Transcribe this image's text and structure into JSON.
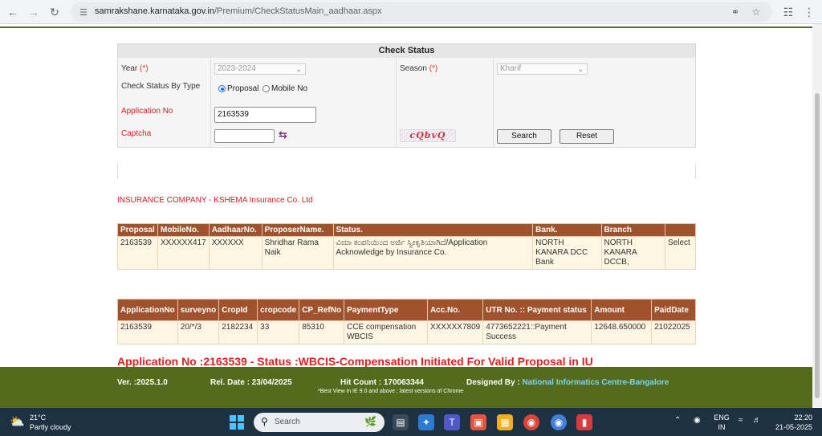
{
  "browser": {
    "url_domain": "samrakshane.karnataka.gov.in",
    "url_path": "/Premium/CheckStatusMain_aadhaar.aspx"
  },
  "check_status": {
    "title": "Check Status",
    "year_label": "Year",
    "required_mark": "(*)",
    "year_value": "2023-2024",
    "season_label": "Season",
    "season_value": "Kharif",
    "check_by_label": "Check Status By Type",
    "radio_proposal": "Proposal",
    "radio_mobile": "Mobile No",
    "radio_selected": "Proposal",
    "application_label": "Application No",
    "application_value": "2163539",
    "captcha_label": "Captcha",
    "captcha_input_value": "",
    "captcha_text": "cQbvQ",
    "search_button": "Search",
    "reset_button": "Reset"
  },
  "insurer_text": "INSURANCE COMPANY - KSHEMA Insurance Co. Ltd",
  "proposal_table": {
    "headers": [
      "Proposal",
      "MobileNo.",
      "AadhaarNo.",
      "ProposerName.",
      "Status.",
      "Bank.",
      "Branch",
      ""
    ],
    "rows": [
      [
        "2163539",
        "XXXXXX417",
        "XXXXXX",
        "Shridhar Rama Naik",
        "ವಿಮಾ ಕಂಪನಿಯಿಂದ ಅರ್ಜಿ ಸ್ವೀಕೃತಿಯಾಗಿದೆ/Application Acknowledge by Insurance Co.",
        "NORTH KANARA DCC Bank",
        "NORTH KANARA DCCB,",
        "Select"
      ]
    ]
  },
  "payment_table": {
    "headers": [
      "ApplicationNo",
      "surveyno",
      "CropId",
      "cropcode",
      "CP_RefNo",
      "PaymentType",
      "Acc.No.",
      "UTR No. :: Payment status",
      "Amount",
      "PaidDate"
    ],
    "rows": [
      [
        "2163539",
        "20/*/3",
        "2182234",
        "33",
        "85310",
        "CCE compensation WBCIS",
        "XXXXXX7809",
        "4773652221::Payment Success",
        "12648.650000",
        "21022025"
      ]
    ]
  },
  "status_message": "Application No :2163539 - Status :WBCIS-Compensation Initiated For Valid Proposal in IU",
  "footer": {
    "version": "Ver. :2025.1.0",
    "release": "Rel. Date : 23/04/2025",
    "hit_count": "Hit Count : 170063344",
    "designed_by_label": "Designed By :",
    "designed_by": "National Informatics Centre-Bangalore",
    "note": "*Best View in IE 9.0 and above ; latest versions of Chrome"
  },
  "taskbar": {
    "temperature": "21°C",
    "weather": "Partly cloudy",
    "search_placeholder": "Search",
    "lang_top": "ENG",
    "lang_bottom": "IN",
    "time": "22:20",
    "date": "21-05-2025"
  },
  "colors": {
    "table_header": "#a0522d",
    "table_cell": "#fdf6e3",
    "footer_bg": "#546b1e",
    "status_red": "#e02020",
    "taskbar_bg": "#1d3142"
  }
}
